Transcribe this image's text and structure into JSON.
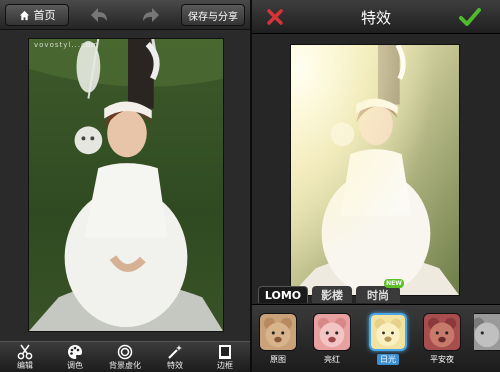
{
  "left_panel": {
    "home_label": "首页",
    "save_share_label": "保存与分享",
    "watermark": "vovostyl...com",
    "tools": [
      {
        "label": "编辑",
        "icon": "scissors-icon"
      },
      {
        "label": "调色",
        "icon": "palette-icon"
      },
      {
        "label": "背景虚化",
        "icon": "target-icon"
      },
      {
        "label": "特效",
        "icon": "magic-wand-icon"
      },
      {
        "label": "边框",
        "icon": "frame-icon"
      }
    ]
  },
  "right_panel": {
    "title": "特效",
    "filter_tabs": [
      "LOMO",
      "影楼",
      "时尚"
    ],
    "new_badge": "NEW",
    "selected_tab": "LOMO",
    "filters": [
      {
        "label": "原图",
        "tint": "#caa27a"
      },
      {
        "label": "亮红",
        "tint": "#e8a0a0"
      },
      {
        "label": "日光",
        "tint": "#f3e3a2"
      },
      {
        "label": "平安夜",
        "tint": "#a84e4e"
      },
      {
        "label": "",
        "tint": "#9a9a9a"
      }
    ],
    "selected_filter": "日光"
  },
  "colors": {
    "accent_blue": "#3d8fd0",
    "close_red": "#d8333a",
    "confirm_green": "#4dbb2a"
  }
}
